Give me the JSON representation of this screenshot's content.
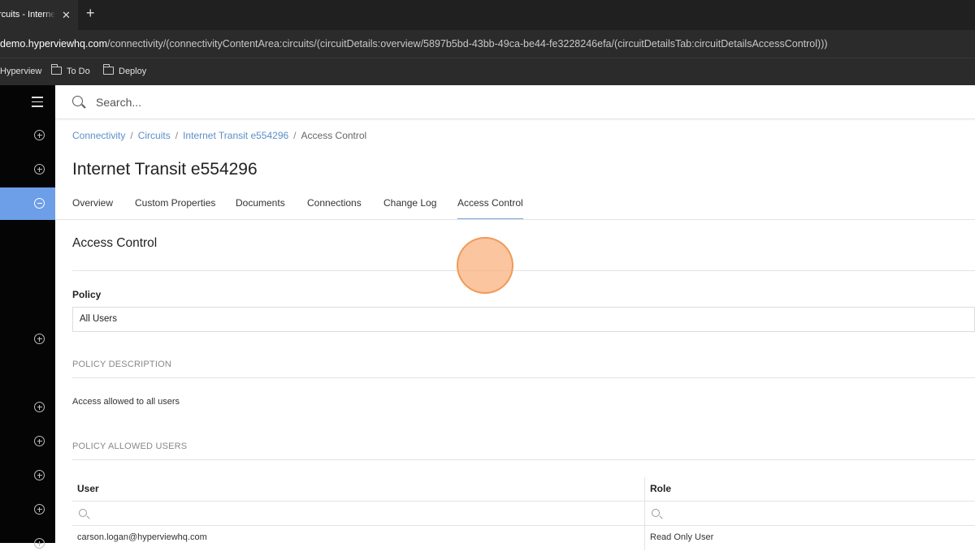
{
  "browser": {
    "tab_title": "rcuits - Interne",
    "tab_close": "✕",
    "new_tab": "+",
    "url_host": "demo.hyperviewhq.com",
    "url_path": "/connectivity/(connectivityContentArea:circuits/(circuitDetails:overview/5897b5bd-43bb-49ca-be44-fe3228246efa/(circuitDetailsTab:circuitDetailsAccessControl)))",
    "bookmarks": [
      "Hyperview",
      "To Do",
      "Deploy"
    ]
  },
  "search": {
    "placeholder": "Search..."
  },
  "breadcrumb": {
    "items": [
      "Connectivity",
      "Circuits",
      "Internet Transit e554296"
    ],
    "current": "Access Control",
    "separator": "/"
  },
  "page_title": "Internet Transit e554296",
  "tabs": [
    {
      "label": "Overview"
    },
    {
      "label": "Custom Properties"
    },
    {
      "label": "Documents"
    },
    {
      "label": "Connections"
    },
    {
      "label": "Change Log"
    },
    {
      "label": "Access Control",
      "active": true
    }
  ],
  "section_title": "Access Control",
  "policy": {
    "label": "Policy",
    "value": "All Users",
    "description_heading": "POLICY DESCRIPTION",
    "description": "Access allowed to all users",
    "allowed_users_heading": "POLICY ALLOWED USERS"
  },
  "users_table": {
    "columns": [
      "User",
      "Role"
    ],
    "rows": [
      {
        "user": "carson.logan@hyperviewhq.com",
        "role": "Read Only User"
      }
    ]
  },
  "colors": {
    "accent": "#6d9ee8",
    "link": "#5b8fc9",
    "cursor_highlight": "#fab280"
  }
}
